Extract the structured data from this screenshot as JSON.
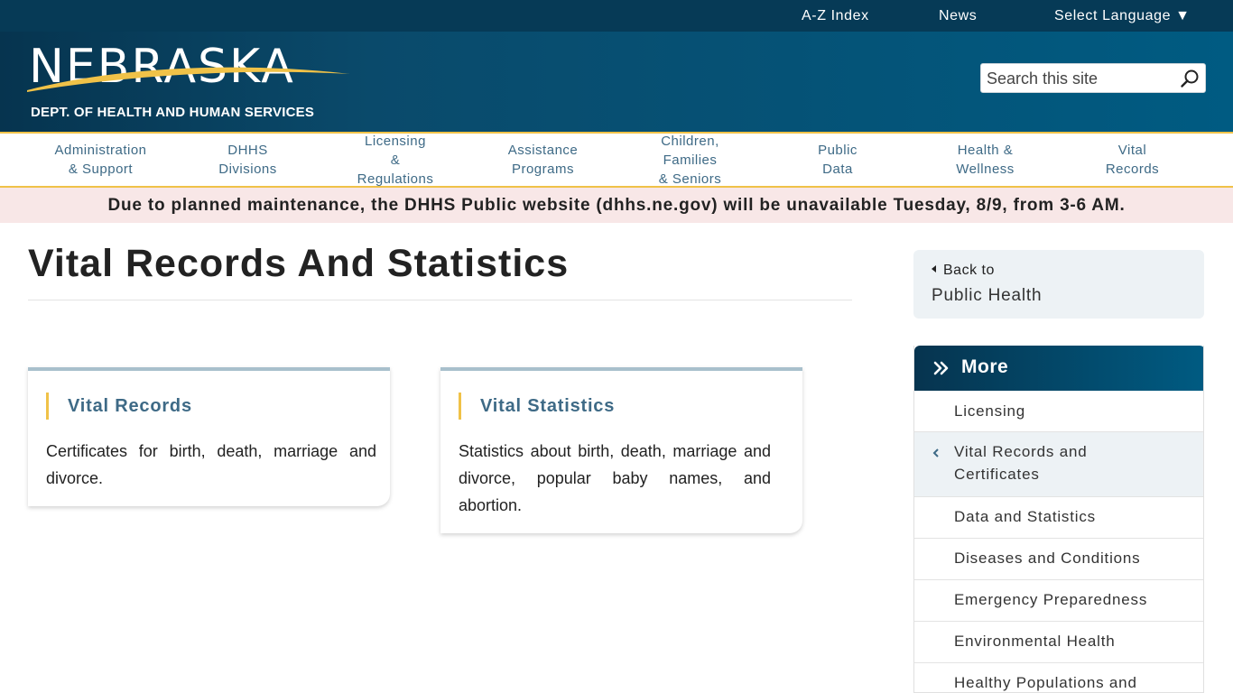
{
  "topbar": {
    "az_index": "A-Z Index",
    "news": "News",
    "language": "Select Language ▼"
  },
  "logo": {
    "wordmark": "NEBRASKA",
    "subtitle": "DEPT. OF HEALTH AND HUMAN SERVICES"
  },
  "search": {
    "placeholder": "Search this site"
  },
  "nav": {
    "items": [
      {
        "label": "Administration\n& Support"
      },
      {
        "label": "DHHS\nDivisions"
      },
      {
        "label": "Licensing\n&\nRegulations"
      },
      {
        "label": "Assistance\nPrograms"
      },
      {
        "label": "Children,\nFamilies\n& Seniors"
      },
      {
        "label": "Public\nData"
      },
      {
        "label": "Health &\nWellness"
      },
      {
        "label": "Vital\nRecords"
      }
    ]
  },
  "alert": {
    "text": "Due to planned maintenance, the DHHS Public website (dhhs.ne.gov) will be unavailable Tuesday, 8/9, from 3-6 AM."
  },
  "page": {
    "title": "Vital Records And Statistics"
  },
  "cards": [
    {
      "title": "Vital Records",
      "description": "Certificates for birth, death, marriage and divorce."
    },
    {
      "title": "Vital Statistics",
      "description": "Statistics about birth, death, marriage and divorce, popular baby names, and abortion."
    }
  ],
  "sidebar": {
    "back_label": "Back to",
    "back_target": "Public Health",
    "more_title": "More",
    "items": [
      {
        "label": "Licensing"
      },
      {
        "label": "Vital Records and\nCertificates"
      },
      {
        "label": "Data and Statistics"
      },
      {
        "label": "Diseases and Conditions"
      },
      {
        "label": "Emergency Preparedness"
      },
      {
        "label": "Environmental Health"
      },
      {
        "label": "Healthy Populations and"
      }
    ]
  },
  "colors": {
    "header_dark": "#06344f",
    "header_light": "#005b82",
    "accent_gold": "#f0c248",
    "link_blue": "#3e6a86",
    "alert_bg": "#f8e7e7"
  }
}
